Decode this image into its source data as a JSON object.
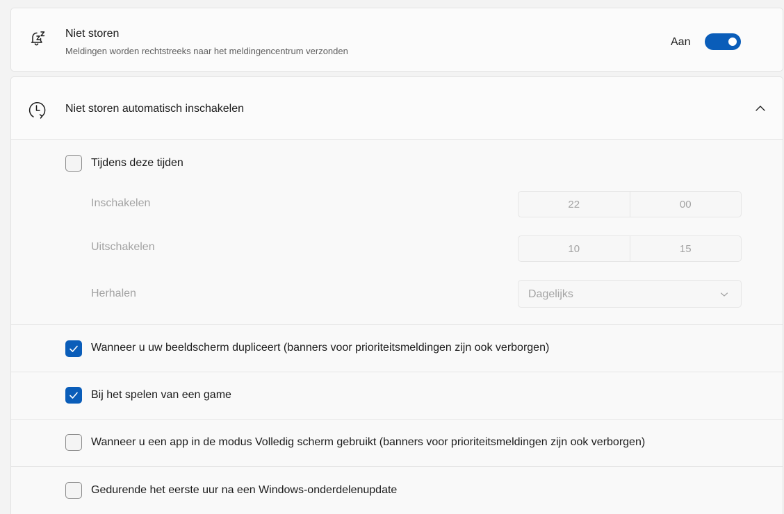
{
  "dnd": {
    "icon": "bell-zzz-icon",
    "title": "Niet storen",
    "subtitle": "Meldingen worden rechtstreeks naar het meldingencentrum verzonden",
    "toggle_label": "Aan",
    "toggle_on": true
  },
  "auto": {
    "icon": "clock-icon",
    "title": "Niet storen automatisch inschakelen",
    "expanded": true,
    "schedule": {
      "checkbox_label": "Tijdens deze tijden",
      "checked": false,
      "on_label": "Inschakelen",
      "on_hour": "22",
      "on_minute": "00",
      "off_label": "Uitschakelen",
      "off_hour": "10",
      "off_minute": "15",
      "repeat_label": "Herhalen",
      "repeat_value": "Dagelijks"
    },
    "options": [
      {
        "label": "Wanneer u uw beeldscherm dupliceert (banners voor prioriteitsmeldingen zijn ook verborgen)",
        "checked": true
      },
      {
        "label": "Bij het spelen van een game",
        "checked": true
      },
      {
        "label": "Wanneer u een app in de modus Volledig scherm gebruikt (banners voor prioriteitsmeldingen zijn ook verborgen)",
        "checked": false
      },
      {
        "label": "Gedurende het eerste uur na een Windows-onderdelenupdate",
        "checked": false
      }
    ]
  },
  "colors": {
    "accent": "#0a5db9",
    "disabled_text": "#a3a3a3"
  }
}
